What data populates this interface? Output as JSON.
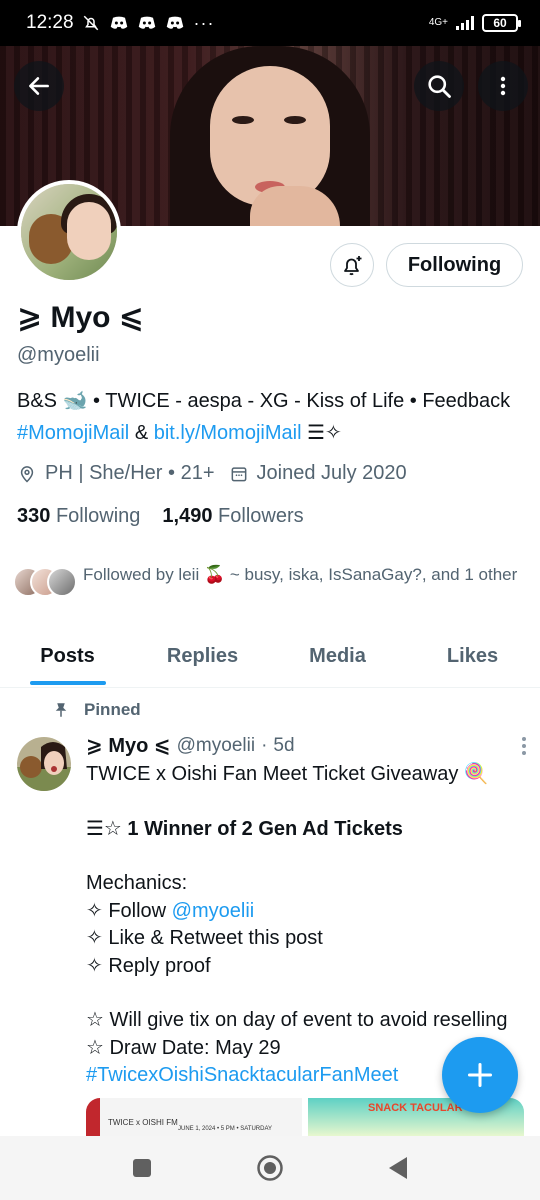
{
  "status_bar": {
    "time": "12:28",
    "network": "4G+",
    "battery": "60",
    "icons": [
      "mute-bell-icon",
      "discord-icon",
      "discord-icon",
      "discord-icon",
      "more-dots-icon"
    ]
  },
  "header": {
    "back_icon": "arrow-left-icon",
    "search_icon": "search-icon",
    "more_icon": "more-vertical-icon"
  },
  "profile": {
    "name": "⩾ Myo ⩽",
    "handle": "@myoelii",
    "bio_line1": "B&S 🐋 • TWICE - aespa - XG - Kiss of Life • Feedback",
    "bio_tag": "#MomojiMail",
    "bio_amp": "&",
    "bio_link": "bit.ly/MomojiMail",
    "bio_tail": "☰✧",
    "location": "PH | She/Her • 21+",
    "joined": "Joined July 2020",
    "following_count": "330",
    "following_label": "Following",
    "followers_count": "1,490",
    "followers_label": "Followers",
    "followed_by": "Followed by leii 🍒 ~ busy, iska, IsSanaGay?, and 1 other",
    "follow_button": "Following"
  },
  "tabs": [
    {
      "label": "Posts",
      "active": true
    },
    {
      "label": "Replies",
      "active": false
    },
    {
      "label": "Media",
      "active": false
    },
    {
      "label": "Likes",
      "active": false
    }
  ],
  "pinned_label": "Pinned",
  "tweet": {
    "display_name": "⩾ Myo ⩽",
    "handle": "@myoelii",
    "sep": "·",
    "time": "5d",
    "line1": "TWICE x Oishi Fan Meet Ticket Giveaway 🍭",
    "line2": "☰☆ 1 Winner of 2 Gen Ad Tickets",
    "line3": "Mechanics:",
    "line4_prefix": "✧ Follow ",
    "line4_mention": "@myoelii",
    "line5": "✧ Like & Retweet this post",
    "line6": "✧ Reply proof",
    "line7": "☆ Will give tix on day of event to avoid reselling",
    "line8": "☆ Draw Date: May 29",
    "hashtag": "#TwicexOishiSnacktacularFanMeet",
    "media1_text": "TWICE x OISHI FM",
    "media1_date": "JUNE 1, 2024 • 5 PM • SATURDAY",
    "media2_text": "SNACK TACULAR"
  },
  "fab_icon": "plus-icon",
  "nav": [
    "recents-square-icon",
    "home-circle-icon",
    "back-triangle-icon"
  ],
  "colors": {
    "accent": "#1d9bf0",
    "text": "#0f1419",
    "secondary": "#536471"
  }
}
